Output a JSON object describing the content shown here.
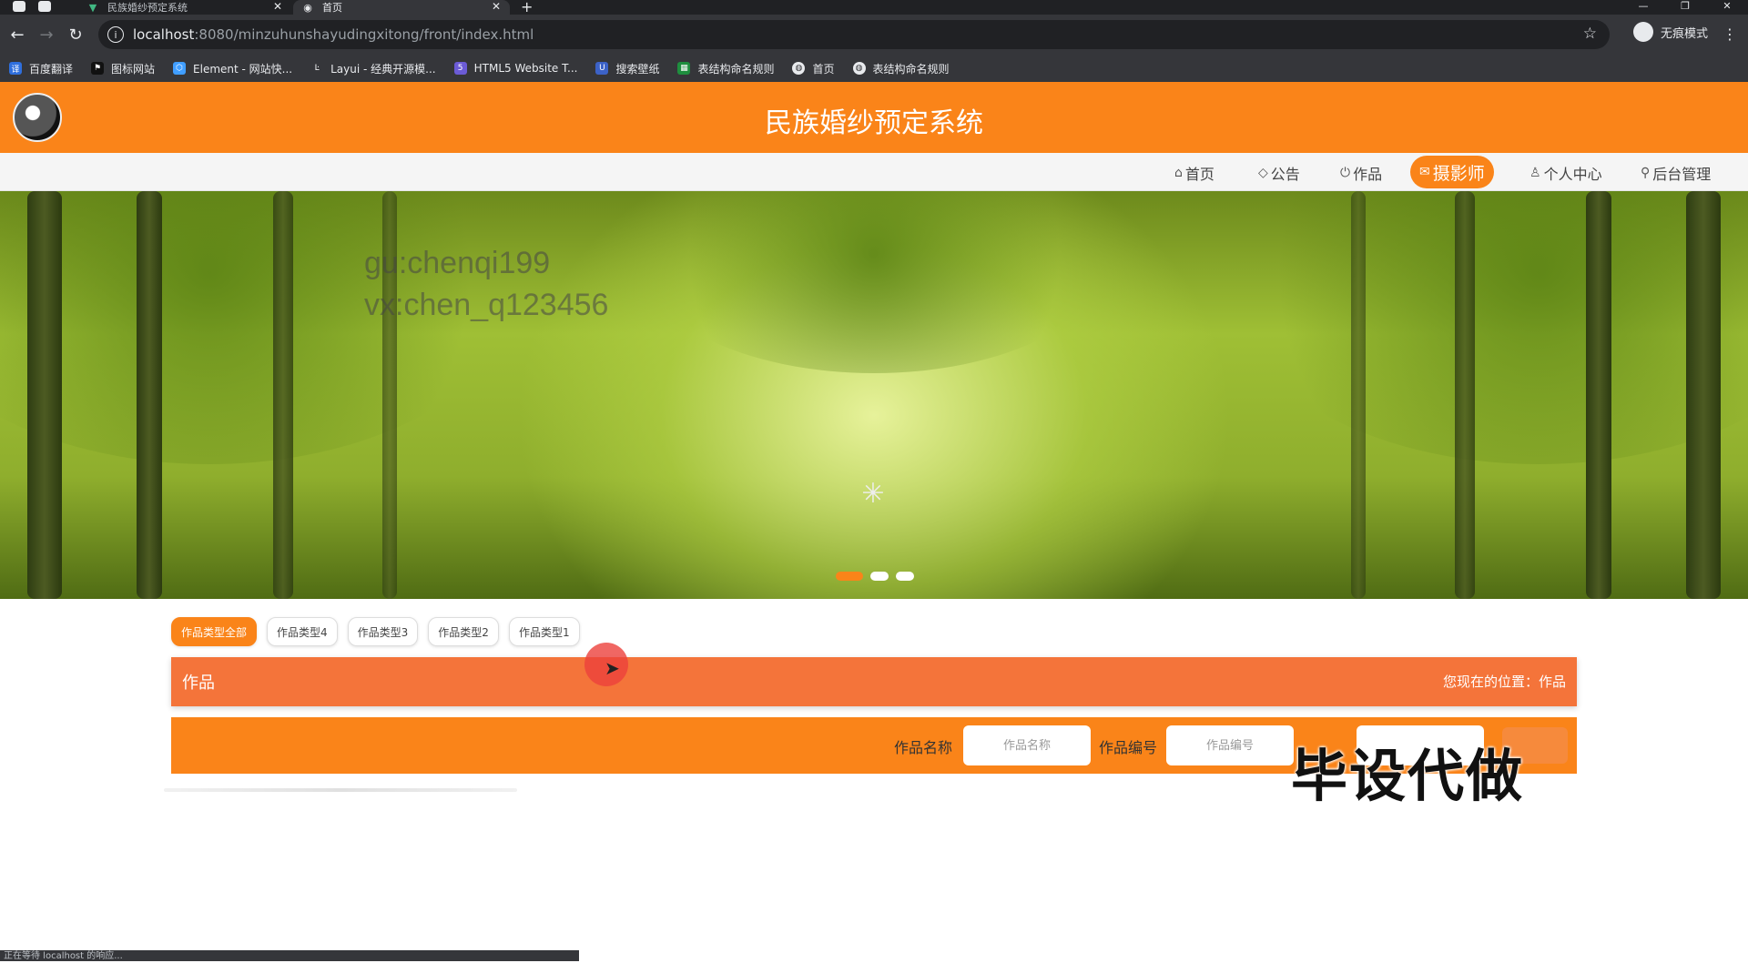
{
  "browser": {
    "tabs": [
      {
        "label": "民族婚纱预定系统",
        "active": false
      },
      {
        "label": "首页",
        "active": true
      }
    ],
    "url_host": "localhost",
    "url_rest": ":8080/minzuhunshayudingxitong/front/index.html",
    "profile_label": "无痕模式",
    "bookmarks": [
      {
        "label": "百度翻译",
        "icon": "translate-icon"
      },
      {
        "label": "图标网站",
        "icon": "flag-icon"
      },
      {
        "label": "Element - 网站快...",
        "icon": "element-icon"
      },
      {
        "label": "Layui - 经典开源模...",
        "icon": "layui-icon"
      },
      {
        "label": "HTML5 Website T...",
        "icon": "html5-icon"
      },
      {
        "label": "搜索壁纸",
        "icon": "wallpaper-icon"
      },
      {
        "label": "表结构命名规则",
        "icon": "sheet-icon"
      },
      {
        "label": "首页",
        "icon": "globe-icon"
      },
      {
        "label": "表结构命名规则",
        "icon": "globe-icon"
      }
    ],
    "status_text": "正在等待 localhost 的响应..."
  },
  "site": {
    "title": "民族婚纱预定系统",
    "brand_color": "#fa8419",
    "nav": [
      {
        "label": "首页",
        "icon": "home-icon",
        "active": false
      },
      {
        "label": "公告",
        "icon": "tag-icon",
        "active": false
      },
      {
        "label": "作品",
        "icon": "power-icon",
        "active": false
      },
      {
        "label": "摄影师",
        "icon": "mail-icon",
        "active": true
      },
      {
        "label": "个人中心",
        "icon": "user-icon",
        "active": false
      },
      {
        "label": "后台管理",
        "icon": "link-icon",
        "active": false
      }
    ]
  },
  "banner": {
    "watermark_line1": "gu:chenqi199",
    "watermark_line2": "vx:chen_q123456",
    "slides": 3,
    "active_slide": 1
  },
  "categories": [
    {
      "label": "作品类型全部",
      "active": true
    },
    {
      "label": "作品类型4",
      "active": false
    },
    {
      "label": "作品类型3",
      "active": false
    },
    {
      "label": "作品类型2",
      "active": false
    },
    {
      "label": "作品类型1",
      "active": false
    }
  ],
  "breadcrumb": {
    "title": "作品",
    "location": "您现在的位置：作品"
  },
  "search": {
    "name_label": "作品名称",
    "name_placeholder": "作品名称",
    "code_label": "作品编号",
    "code_placeholder": "作品编号",
    "overlay_text": "毕设代做"
  }
}
